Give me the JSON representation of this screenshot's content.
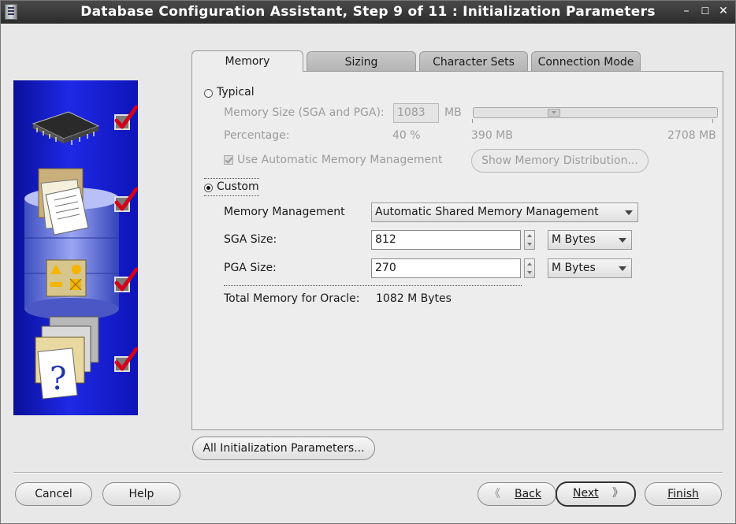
{
  "window": {
    "title": "Database Configuration Assistant, Step 9 of 11 : Initialization Parameters",
    "minimize": "–",
    "maximize": "☐",
    "close": "✕"
  },
  "tabs": [
    {
      "label": "Memory",
      "active": true
    },
    {
      "label": "Sizing",
      "active": false
    },
    {
      "label": "Character Sets",
      "active": false
    },
    {
      "label": "Connection Mode",
      "active": false
    }
  ],
  "memory": {
    "typical": {
      "label": "Typical",
      "selected": false,
      "memory_size_label": "Memory Size (SGA and PGA):",
      "memory_size_value": "1083",
      "memory_size_unit": "MB",
      "percentage_label": "Percentage:",
      "percentage_value": "40 %",
      "slider_min_label": "390 MB",
      "slider_max_label": "2708 MB",
      "slider_fraction": 0.32,
      "auto_memory_label": "Use Automatic Memory Management",
      "auto_memory_checked": true,
      "show_distribution_label": "Show Memory Distribution..."
    },
    "custom": {
      "label": "Custom",
      "selected": true,
      "memory_management_label": "Memory Management",
      "memory_management_value": "Automatic Shared Memory Management",
      "sga_label": "SGA Size:",
      "sga_value": "812",
      "sga_unit": "M Bytes",
      "pga_label": "PGA Size:",
      "pga_value": "270",
      "pga_unit": "M Bytes",
      "total_label": "Total Memory for Oracle:",
      "total_value": "1082 M Bytes"
    }
  },
  "all_params_label": "All Initialization Parameters...",
  "footer": {
    "cancel": "Cancel",
    "help": "Help",
    "back": "Back",
    "next": "Next",
    "finish": "Finish"
  },
  "colors": {
    "panel_blue": "#1f29e6",
    "check_red": "#d4001a",
    "titlebar": "#2b2b2b"
  }
}
